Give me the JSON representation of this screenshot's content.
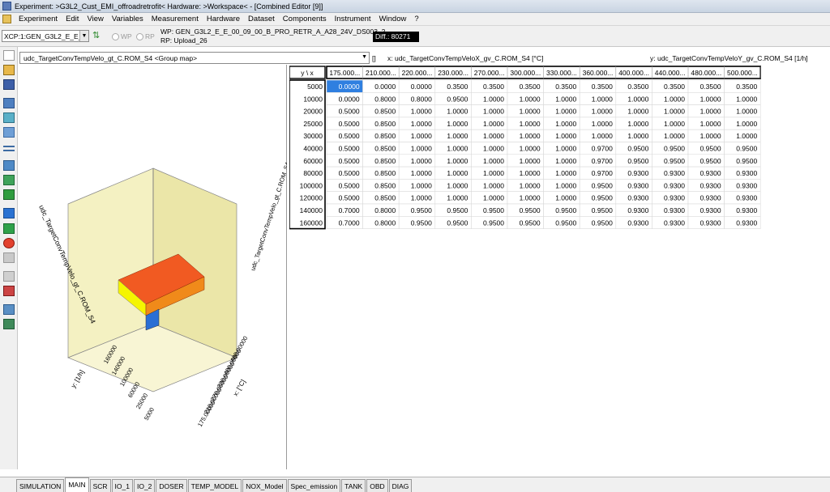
{
  "window": {
    "title": "Experiment: >G3L2_Cust_EMI_offroadretrofit< Hardware: >Workspace< - [Combined Editor [9]]"
  },
  "menu": [
    "Experiment",
    "Edit",
    "View",
    "Variables",
    "Measurement",
    "Hardware",
    "Dataset",
    "Components",
    "Instrument",
    "Window",
    "?"
  ],
  "toolbar": {
    "xcp_device": "XCP:1:GEN_G3L2_E_E_0",
    "wp_label": "WP",
    "rp_label": "RP",
    "wp_info": "WP: GEN_G3L2_E_E_00_09_00_B_PRO_RETR_A_A28_24V_DS003_2",
    "rp_info": "RP: Upload_26",
    "diff": "Diff.: 80271"
  },
  "map": {
    "name": "udc_TargetConvTempVelo_gt_C.ROM_S4 <Group map>",
    "unit": "[]",
    "x_axis": "x:  udc_TargetConvTempVeloX_gv_C.ROM_S4 [°C]",
    "y_axis": "y:  udc_TargetConvTempVeloY_gv_C.ROM_S4 [1/h]",
    "corner": "y \\ x"
  },
  "table": {
    "x_values": [
      "175.000...",
      "210.000...",
      "220.000...",
      "230.000...",
      "270.000...",
      "300.000...",
      "330.000...",
      "360.000...",
      "400.000...",
      "440.000...",
      "480.000...",
      "500.000..."
    ],
    "rows": [
      {
        "y": "5000",
        "v": [
          "0.0000",
          "0.0000",
          "0.0000",
          "0.3500",
          "0.3500",
          "0.3500",
          "0.3500",
          "0.3500",
          "0.3500",
          "0.3500",
          "0.3500",
          "0.3500"
        ]
      },
      {
        "y": "10000",
        "v": [
          "0.0000",
          "0.8000",
          "0.8000",
          "0.9500",
          "1.0000",
          "1.0000",
          "1.0000",
          "1.0000",
          "1.0000",
          "1.0000",
          "1.0000",
          "1.0000"
        ]
      },
      {
        "y": "20000",
        "v": [
          "0.5000",
          "0.8500",
          "1.0000",
          "1.0000",
          "1.0000",
          "1.0000",
          "1.0000",
          "1.0000",
          "1.0000",
          "1.0000",
          "1.0000",
          "1.0000"
        ]
      },
      {
        "y": "25000",
        "v": [
          "0.5000",
          "0.8500",
          "1.0000",
          "1.0000",
          "1.0000",
          "1.0000",
          "1.0000",
          "1.0000",
          "1.0000",
          "1.0000",
          "1.0000",
          "1.0000"
        ]
      },
      {
        "y": "30000",
        "v": [
          "0.5000",
          "0.8500",
          "1.0000",
          "1.0000",
          "1.0000",
          "1.0000",
          "1.0000",
          "1.0000",
          "1.0000",
          "1.0000",
          "1.0000",
          "1.0000"
        ]
      },
      {
        "y": "40000",
        "v": [
          "0.5000",
          "0.8500",
          "1.0000",
          "1.0000",
          "1.0000",
          "1.0000",
          "1.0000",
          "0.9700",
          "0.9500",
          "0.9500",
          "0.9500",
          "0.9500"
        ]
      },
      {
        "y": "60000",
        "v": [
          "0.5000",
          "0.8500",
          "1.0000",
          "1.0000",
          "1.0000",
          "1.0000",
          "1.0000",
          "0.9700",
          "0.9500",
          "0.9500",
          "0.9500",
          "0.9500"
        ]
      },
      {
        "y": "80000",
        "v": [
          "0.5000",
          "0.8500",
          "1.0000",
          "1.0000",
          "1.0000",
          "1.0000",
          "1.0000",
          "0.9700",
          "0.9300",
          "0.9300",
          "0.9300",
          "0.9300"
        ]
      },
      {
        "y": "100000",
        "v": [
          "0.5000",
          "0.8500",
          "1.0000",
          "1.0000",
          "1.0000",
          "1.0000",
          "1.0000",
          "0.9500",
          "0.9300",
          "0.9300",
          "0.9300",
          "0.9300"
        ]
      },
      {
        "y": "120000",
        "v": [
          "0.5000",
          "0.8500",
          "1.0000",
          "1.0000",
          "1.0000",
          "1.0000",
          "1.0000",
          "0.9500",
          "0.9300",
          "0.9300",
          "0.9300",
          "0.9300"
        ]
      },
      {
        "y": "140000",
        "v": [
          "0.7000",
          "0.8000",
          "0.9500",
          "0.9500",
          "0.9500",
          "0.9500",
          "0.9500",
          "0.9500",
          "0.9300",
          "0.9300",
          "0.9300",
          "0.9300"
        ]
      },
      {
        "y": "160000",
        "v": [
          "0.7000",
          "0.8000",
          "0.9500",
          "0.9500",
          "0.9500",
          "0.9500",
          "0.9500",
          "0.9500",
          "0.9300",
          "0.9300",
          "0.9300",
          "0.9300"
        ]
      }
    ],
    "selected_cell": {
      "row": 0,
      "col": 0
    }
  },
  "plot3d": {
    "z_title": "udc_TargetConvTempVelo_gt_C.ROM_S4",
    "x_title": "x: [°C]",
    "y_title": "y: [1/h]",
    "x_ticks": [
      "175.00000",
      "210.00000",
      "270.00000",
      "330.00000",
      "400.00000",
      "480.00000"
    ],
    "y_ticks": [
      "5000",
      "25000",
      "60000",
      "100000",
      "140000",
      "160000"
    ]
  },
  "tabs": [
    "SIMULATION",
    "MAIN",
    "SCR",
    "IO_1",
    "IO_2",
    "DOSER",
    "TEMP_MODEL",
    "NOX_Model",
    "Spec_emission",
    "TANK",
    "OBD",
    "DIAG"
  ],
  "active_tab": "MAIN",
  "colors": {
    "surface_high": "#f15a22",
    "surface_mid": "#f5f500",
    "surface_low": "#2a6fd4",
    "selection": "#2f7fe0"
  }
}
